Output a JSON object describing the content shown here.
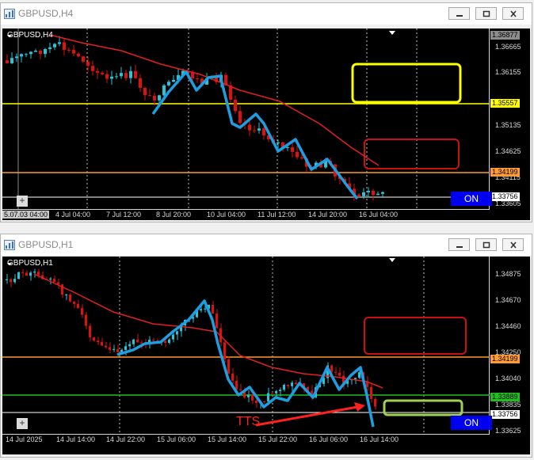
{
  "top": {
    "title": "GBPUSD,H4",
    "symbol": "GBPUSD,H4",
    "prices": [
      "1.36665",
      "1.36155",
      "1.35135",
      "1.34625",
      "1.34115",
      "1.33605"
    ],
    "hl_top": "1.36877",
    "hl_yellow": "1.35557",
    "hl_orange": "1.34199",
    "hl_white": "1.33756",
    "times": [
      "5.07.03 04:00",
      "4 Jul 04:00",
      "7 Jul 12:00",
      "8 Jul 20:00",
      "10 Jul 04:00",
      "11 Jul 12:00",
      "14 Jul 20:00",
      "16 Jul 04:00"
    ],
    "on_label": "ON",
    "plus": "+"
  },
  "bottom": {
    "title": "GBPUSD,H1",
    "symbol": "GBPUSD,H1",
    "prices": [
      "1.34875",
      "1.34670",
      "1.34460",
      "1.34250",
      "1.34040",
      "1.33835",
      "1.33625"
    ],
    "hl_orange": "1.34199",
    "hl_green": "1.33889",
    "hl_white": "1.33756",
    "times": [
      "14 Jul 2025",
      "14 Jul 14:00",
      "14 Jul 22:00",
      "15 Jul 06:00",
      "15 Jul 14:00",
      "15 Jul 22:00",
      "16 Jul 06:00",
      "16 Jul 14:00"
    ],
    "on_label": "ON",
    "plus": "+",
    "annotation": "TTS"
  },
  "colors": {
    "bull": "#26c6da",
    "bear": "#e01010",
    "ma": "#e02020",
    "trend": "#1e9ee0",
    "yellow": "#ffff00",
    "orange": "#ff9b2f",
    "green": "#1fbf1f",
    "on_button": "#0000f0"
  }
}
